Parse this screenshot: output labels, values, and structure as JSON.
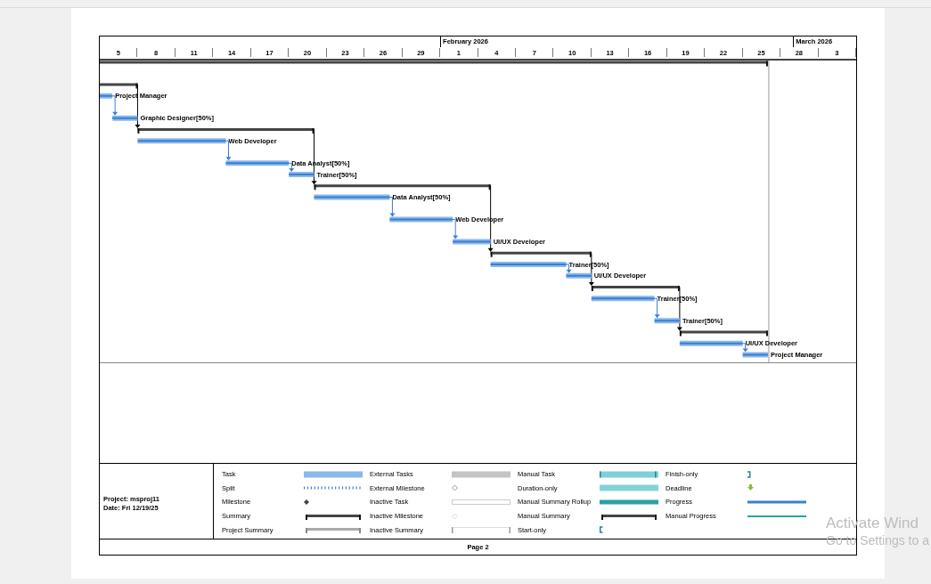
{
  "timescale": {
    "months": [
      "February 2026",
      "March 2026"
    ],
    "days": [
      "5",
      "8",
      "11",
      "14",
      "17",
      "20",
      "23",
      "26",
      "29",
      "1",
      "4",
      "7",
      "10",
      "13",
      "16",
      "19",
      "22",
      "25",
      "28",
      "3"
    ]
  },
  "tasks": [
    {
      "kind": "summary"
    },
    {
      "kind": "summary"
    },
    {
      "kind": "task",
      "resource": "Project Manager"
    },
    {
      "kind": "task",
      "resource": "Graphic Designer[50%]"
    },
    {
      "kind": "summary"
    },
    {
      "kind": "task",
      "resource": "Web Developer"
    },
    {
      "kind": "task",
      "resource": "Data Analyst[50%]"
    },
    {
      "kind": "task",
      "resource": "Trainer[50%]"
    },
    {
      "kind": "summary"
    },
    {
      "kind": "task",
      "resource": "Data Analyst[50%]"
    },
    {
      "kind": "task",
      "resource": "Web Developer"
    },
    {
      "kind": "task",
      "resource": "UI/UX Developer"
    },
    {
      "kind": "summary"
    },
    {
      "kind": "task",
      "resource": "Trainer[50%]"
    },
    {
      "kind": "task",
      "resource": "UI/UX Developer"
    },
    {
      "kind": "summary"
    },
    {
      "kind": "task",
      "resource": "Trainer[50%]"
    },
    {
      "kind": "task",
      "resource": "Trainer[50%]"
    },
    {
      "kind": "summary"
    },
    {
      "kind": "task",
      "resource": "UI/UX Developer"
    },
    {
      "kind": "task",
      "resource": "Project Manager"
    }
  ],
  "legend": {
    "project": "Project: msproj11",
    "date": "Date: Fri 12/19/25",
    "columns": [
      {
        "items": [
          {
            "label": "Task",
            "kind": "task"
          },
          {
            "label": "Split",
            "kind": "split"
          },
          {
            "label": "Milestone",
            "kind": "milestone"
          },
          {
            "label": "Summary",
            "kind": "summary"
          },
          {
            "label": "Project Summary",
            "kind": "projsummary"
          }
        ]
      },
      {
        "items": [
          {
            "label": "External Tasks",
            "kind": "external"
          },
          {
            "label": "External Milestone",
            "kind": "extmilestone"
          },
          {
            "label": "Inactive Task",
            "kind": "inactivetask"
          },
          {
            "label": "Inactive Milestone",
            "kind": "inactivemilestone"
          },
          {
            "label": "Inactive Summary",
            "kind": "inactivesummary"
          }
        ]
      },
      {
        "items": [
          {
            "label": "Manual Task",
            "kind": "manualtask"
          },
          {
            "label": "Duration-only",
            "kind": "durationonly"
          },
          {
            "label": "Manual Summary Rollup",
            "kind": "rollup"
          },
          {
            "label": "Manual Summary",
            "kind": "manualsummary"
          },
          {
            "label": "Start-only",
            "kind": "startonly"
          }
        ]
      },
      {
        "items": [
          {
            "label": "Finish-only",
            "kind": "finishonly"
          },
          {
            "label": "Deadline",
            "kind": "deadline"
          },
          {
            "label": "Progress",
            "kind": "progress"
          },
          {
            "label": "Manual Progress",
            "kind": "manualprogress"
          }
        ]
      }
    ]
  },
  "footer": "Page 2",
  "activation": {
    "title": "Activate Wind",
    "subtitle": "Go to Settings to a"
  }
}
